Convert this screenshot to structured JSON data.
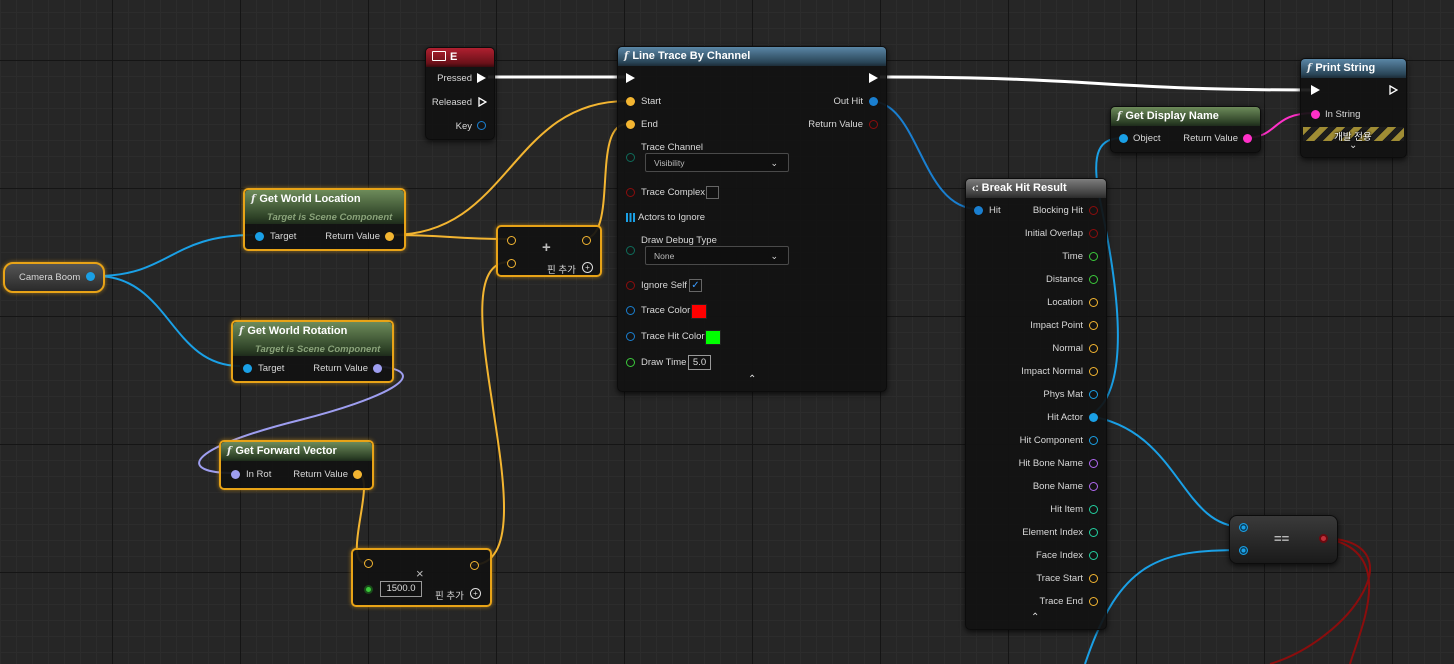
{
  "colors": {
    "exec": "#ffffff",
    "vector": "#f3b531",
    "object": "#1aa0e6",
    "rotator": "#9e9ef0",
    "float": "#3bc93b",
    "bool": "#8b0d0d",
    "string": "#ff30c8",
    "struct": "#0070d8",
    "name": "#b068f0",
    "int": "#23d0a0",
    "channel": "#0f6b5a",
    "structWire": "#1a7fd0"
  },
  "key_event": {
    "title": "E",
    "pins": {
      "pressed": "Pressed",
      "released": "Released",
      "key": "Key"
    }
  },
  "camera_boom": {
    "label": "Camera Boom"
  },
  "get_world_location": {
    "title": "Get World Location",
    "subtitle": "Target is Scene Component",
    "target": "Target",
    "return_value": "Return Value"
  },
  "get_world_rotation": {
    "title": "Get World Rotation",
    "subtitle": "Target is Scene Component",
    "target": "Target",
    "return_value": "Return Value"
  },
  "get_forward_vector": {
    "title": "Get Forward Vector",
    "in_rot": "In Rot",
    "return_value": "Return Value"
  },
  "add_node": {
    "symbol": "+",
    "add_pin": "핀 추가"
  },
  "multiply_node": {
    "symbol": "×",
    "value": "1500.0",
    "add_pin": "핀 추가"
  },
  "line_trace": {
    "title": "Line Trace By Channel",
    "start": "Start",
    "end": "End",
    "out_hit": "Out Hit",
    "return_value": "Return Value",
    "trace_channel": "Trace Channel",
    "trace_channel_value": "Visibility",
    "trace_complex": "Trace Complex",
    "actors_to_ignore": "Actors to Ignore",
    "draw_debug_type": "Draw Debug Type",
    "draw_debug_value": "None",
    "ignore_self": "Ignore Self",
    "ignore_self_checked": true,
    "trace_color": "Trace Color",
    "trace_color_value": "#ff0000",
    "trace_hit_color": "Trace Hit Color",
    "trace_hit_color_value": "#00ff00",
    "draw_time": "Draw Time",
    "draw_time_value": "5.0"
  },
  "break_hit": {
    "title": "Break Hit Result",
    "hit": "Hit",
    "outputs": [
      {
        "label": "Blocking Hit",
        "type": "bool"
      },
      {
        "label": "Initial Overlap",
        "type": "bool"
      },
      {
        "label": "Time",
        "type": "float"
      },
      {
        "label": "Distance",
        "type": "float"
      },
      {
        "label": "Location",
        "type": "vector"
      },
      {
        "label": "Impact Point",
        "type": "vector"
      },
      {
        "label": "Normal",
        "type": "vector"
      },
      {
        "label": "Impact Normal",
        "type": "vector"
      },
      {
        "label": "Phys Mat",
        "type": "object"
      },
      {
        "label": "Hit Actor",
        "type": "object"
      },
      {
        "label": "Hit Component",
        "type": "object"
      },
      {
        "label": "Hit Bone Name",
        "type": "name"
      },
      {
        "label": "Bone Name",
        "type": "name"
      },
      {
        "label": "Hit Item",
        "type": "int"
      },
      {
        "label": "Element Index",
        "type": "int"
      },
      {
        "label": "Face Index",
        "type": "int"
      },
      {
        "label": "Trace Start",
        "type": "vector"
      },
      {
        "label": "Trace End",
        "type": "vector"
      }
    ]
  },
  "get_display_name": {
    "title": "Get Display Name",
    "object": "Object",
    "return_value": "Return Value"
  },
  "print_string": {
    "title": "Print String",
    "in_string": "In String",
    "dev_label": "개발 전용"
  },
  "equal_node": {
    "symbol": "=="
  }
}
